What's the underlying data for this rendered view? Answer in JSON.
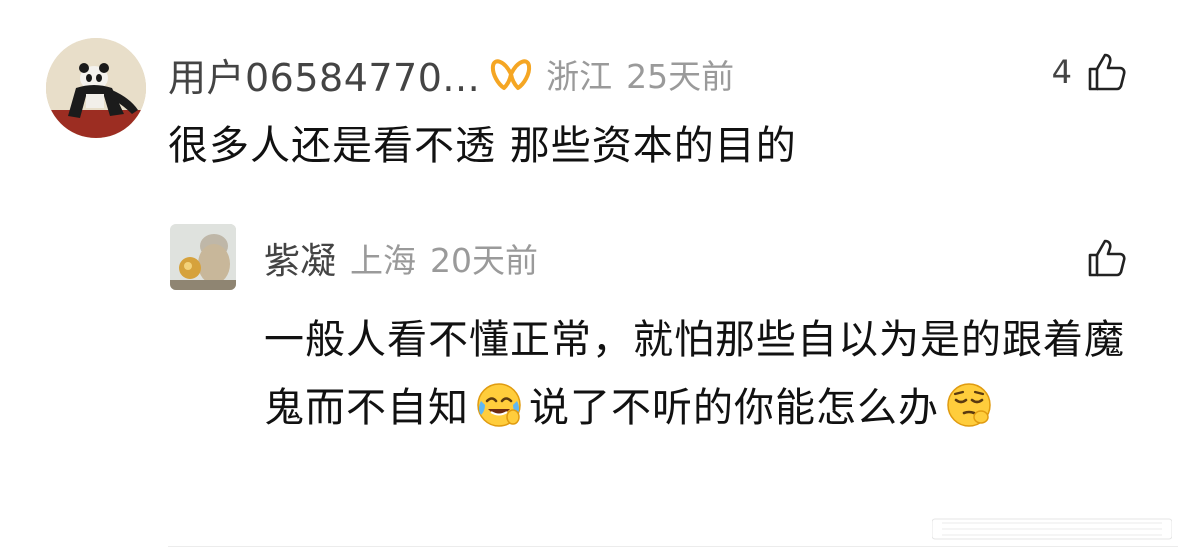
{
  "comment": {
    "username": "用户06584770...",
    "location": "浙江",
    "time": "25天前",
    "likes": "4",
    "text": "很多人还是看不透  那些资本的目的",
    "icons": {
      "vip_badge": "vip-ribbon-icon",
      "like": "thumbs-up-icon"
    },
    "colors": {
      "vip_badge": "#f5a623",
      "meta_gray": "#9a9a9a"
    }
  },
  "reply": {
    "username": "紫凝",
    "location": "上海",
    "time": "20天前",
    "text_part1": "一般人看不懂正常，就怕那些自以为是的跟着魔鬼而不自知",
    "emoji1": "face-with-tears-of-joy-emoji",
    "text_part2": "说了不听的你能怎么办",
    "emoji2": "relieved-smirk-emoji",
    "icons": {
      "like": "thumbs-up-icon"
    }
  }
}
